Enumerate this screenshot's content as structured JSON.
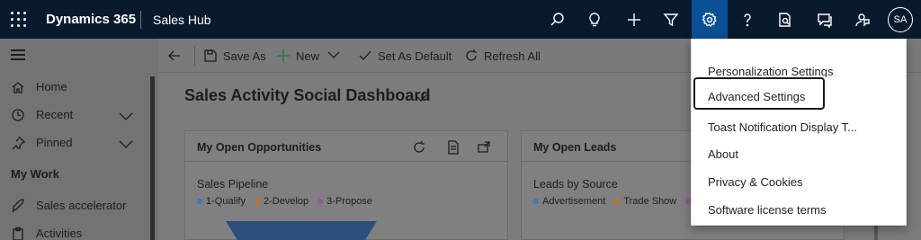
{
  "topbar": {
    "brand": "Dynamics 365",
    "app_name": "Sales Hub",
    "icons": [
      "search-icon",
      "lightbulb-icon",
      "plus-icon",
      "filter-icon",
      "gear-icon",
      "help-icon",
      "insights-icon",
      "chat-icon",
      "feedback-icon"
    ],
    "avatar_initials": "SA",
    "active_color": "#0b4f95"
  },
  "sidebar": {
    "items": [
      {
        "label": "Home",
        "icon": "home-icon"
      },
      {
        "label": "Recent",
        "icon": "clock-icon",
        "expandable": true
      },
      {
        "label": "Pinned",
        "icon": "pin-icon",
        "expandable": true
      }
    ],
    "section_title": "My Work",
    "work_items": [
      {
        "label": "Sales accelerator",
        "icon": "rocket-icon"
      },
      {
        "label": "Activities",
        "icon": "clipboard-icon"
      }
    ]
  },
  "commandbar": {
    "save_as": "Save As",
    "new": "New",
    "set_default": "Set As Default",
    "refresh_all": "Refresh All"
  },
  "dashboard": {
    "title": "Sales Activity Social Dashboard",
    "cards": [
      {
        "title": "My Open Opportunities",
        "chart_title": "Sales Pipeline",
        "legend": [
          {
            "label": "1-Qualify",
            "color": "#3a78c2"
          },
          {
            "label": "2-Develop",
            "color": "#c9701f"
          },
          {
            "label": "3-Propose",
            "color": "#9b4fa6"
          }
        ]
      },
      {
        "title": "My Open Leads",
        "chart_title": "Leads by Source",
        "legend": [
          {
            "label": "Advertisement",
            "color": "#3a78c2"
          },
          {
            "label": "Trade Show",
            "color": "#c9701f"
          },
          {
            "label": "",
            "color": "#9b4fa6"
          }
        ]
      }
    ]
  },
  "settings_menu": {
    "items": [
      "Personalization Settings",
      "Advanced Settings",
      "Toast Notification Display T...",
      "About",
      "Privacy & Cookies",
      "Software license terms"
    ],
    "focused_index": 1
  }
}
